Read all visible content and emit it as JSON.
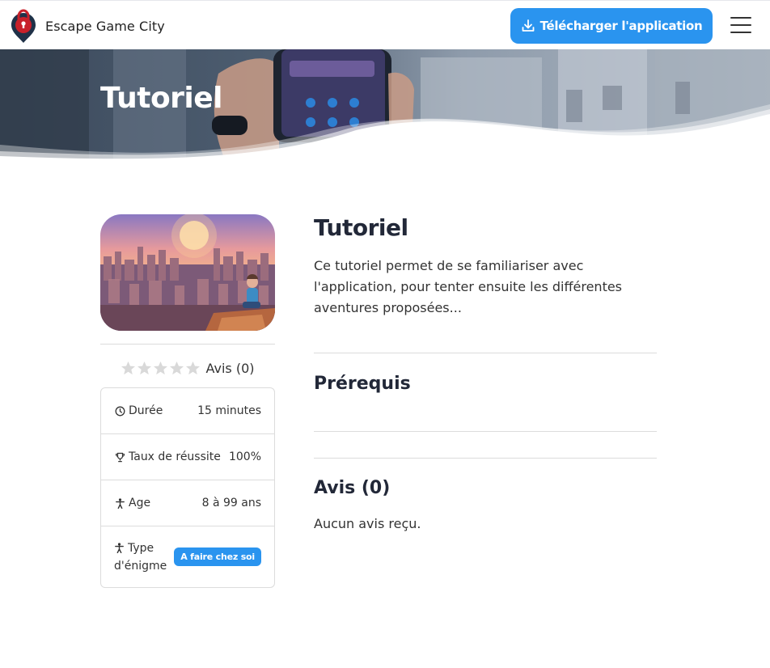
{
  "navbar": {
    "brand_name": "Escape Game City",
    "download_label": "Télécharger l'application"
  },
  "hero": {
    "title": "Tutoriel"
  },
  "sidebar": {
    "rating": {
      "stars": 0,
      "max_stars": 5,
      "label": "Avis (0)"
    },
    "info": [
      {
        "icon": "clock-icon",
        "label": "Durée",
        "value": "15 minutes"
      },
      {
        "icon": "trophy-icon",
        "label": "Taux de réussite",
        "value": "100%"
      },
      {
        "icon": "person-icon",
        "label": "Age",
        "value": "8 à 99 ans"
      },
      {
        "icon": "person-icon",
        "label_line1": "Type",
        "label_line2": "d'énigme",
        "badge": "A faire chez soi"
      }
    ]
  },
  "main": {
    "title": "Tutoriel",
    "description": "Ce tutoriel permet de se familiariser avec l'application, pour tenter ensuite les différentes aventures proposées...",
    "prereq_heading": "Prérequis",
    "reviews_heading": "Avis (0)",
    "no_reviews": "Aucun avis reçu."
  },
  "colors": {
    "accent": "#2a94ef",
    "heading": "#222838",
    "border": "#dcdcdc",
    "star_empty": "#d9d9d9",
    "logo_red": "#c8202a",
    "logo_navy": "#1f3148"
  }
}
